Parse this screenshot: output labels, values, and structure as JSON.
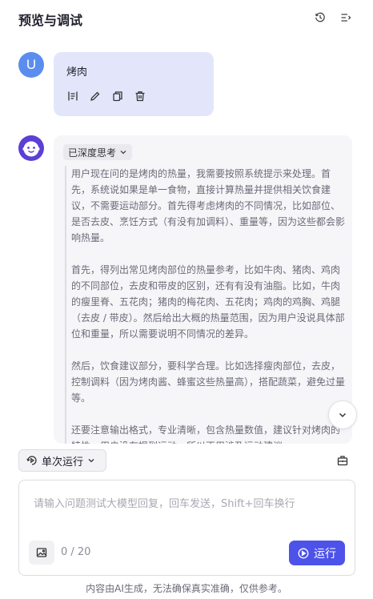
{
  "header": {
    "title": "预览与调试",
    "icons": [
      "history-icon",
      "menu-collapse-icon"
    ]
  },
  "user_message": {
    "avatar_letter": "U",
    "text": "烤肉",
    "actions": [
      "edit-format-icon",
      "pencil-icon",
      "copy-icon",
      "trash-icon"
    ]
  },
  "bot_message": {
    "avatar_icon": "bot-face-icon",
    "thinking_toggle_label": "已深度思考",
    "thinking_paragraphs": [
      "用户现在问的是烤肉的热量，我需要按照系统提示来处理。首先，系统说如果是单一食物，直接计算热量并提供相关饮食建议，不需要运动部分。首先得考虑烤肉的不同情况，比如部位、是否去皮、烹饪方式（有没有加调料）、重量等，因为这些都会影响热量。",
      "首先，得列出常见烤肉部位的热量参考，比如牛肉、猪肉、鸡肉的不同部位，去皮和带皮的区别，还有有没有油脂。比如，牛肉的瘦里脊、五花肉；猪肉的梅花肉、五花肉；鸡肉的鸡胸、鸡腿（去皮 / 带皮）。然后给出大概的热量范围，因为用户没说具体部位和重量，所以需要说明不同情况的差异。",
      "然后，饮食建议部分，要科学合理。比如选择瘦肉部位，去皮，控制调料（因为烤肉酱、蜂蜜这些热量高），搭配蔬菜，避免过量等。",
      "还要注意输出格式，专业清晰，包含热量数值，建议针对烤肉的特性，用户没有提到运动，所以不用涉及运动建议。"
    ]
  },
  "controls": {
    "run_mode_label": "单次运行",
    "input_placeholder": "请输入问题测试大模型回复，回车发送，Shift+回车换行",
    "input_value": "",
    "counter": "0 / 20",
    "run_button_label": "运行"
  },
  "footer": {
    "disclaimer": "内容由AI生成，无法确保真实准确，仅供参考。"
  },
  "colors": {
    "accent": "#4d53e8",
    "user_bubble": "#e3e6fb",
    "user_avatar": "#5b8def",
    "bot_avatar": "#5c3fd6"
  }
}
